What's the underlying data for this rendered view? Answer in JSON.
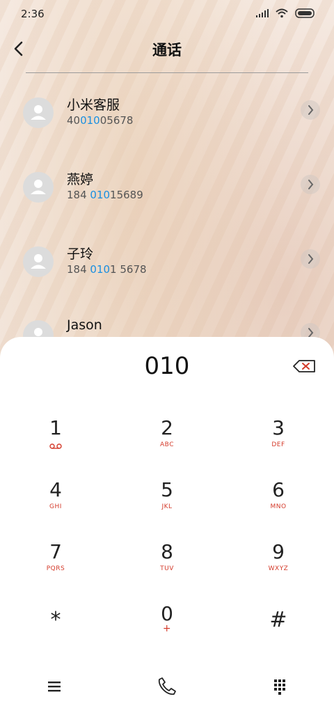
{
  "status": {
    "time": "2:36"
  },
  "header": {
    "title": "通话"
  },
  "contacts": [
    {
      "name": "小米客服",
      "number_parts": [
        "40",
        "010",
        "05678"
      ]
    },
    {
      "name": "燕婷",
      "number_parts": [
        "184 ",
        "010",
        "15689"
      ]
    },
    {
      "name": "子玲",
      "number_parts": [
        "184 ",
        "010",
        "1 5678"
      ]
    },
    {
      "name": "Jason",
      "number_parts": [
        "",
        "",
        ""
      ]
    }
  ],
  "dialer": {
    "input": "010",
    "keys": [
      {
        "digit": "1",
        "letters": ""
      },
      {
        "digit": "2",
        "letters": "ABC"
      },
      {
        "digit": "3",
        "letters": "DEF"
      },
      {
        "digit": "4",
        "letters": "GHI"
      },
      {
        "digit": "5",
        "letters": "JKL"
      },
      {
        "digit": "6",
        "letters": "MNO"
      },
      {
        "digit": "7",
        "letters": "PQRS"
      },
      {
        "digit": "8",
        "letters": "TUV"
      },
      {
        "digit": "9",
        "letters": "WXYZ"
      },
      {
        "digit": "*",
        "letters": ""
      },
      {
        "digit": "0",
        "letters": "+"
      },
      {
        "digit": "#",
        "letters": ""
      }
    ]
  },
  "icons": {
    "voicemail": "voicemail-icon",
    "menu": "menu-icon",
    "call": "phone-icon",
    "keypad": "keypad-icon"
  },
  "colors": {
    "highlight": "#1a8fe0",
    "letters": "#d43a2a"
  }
}
